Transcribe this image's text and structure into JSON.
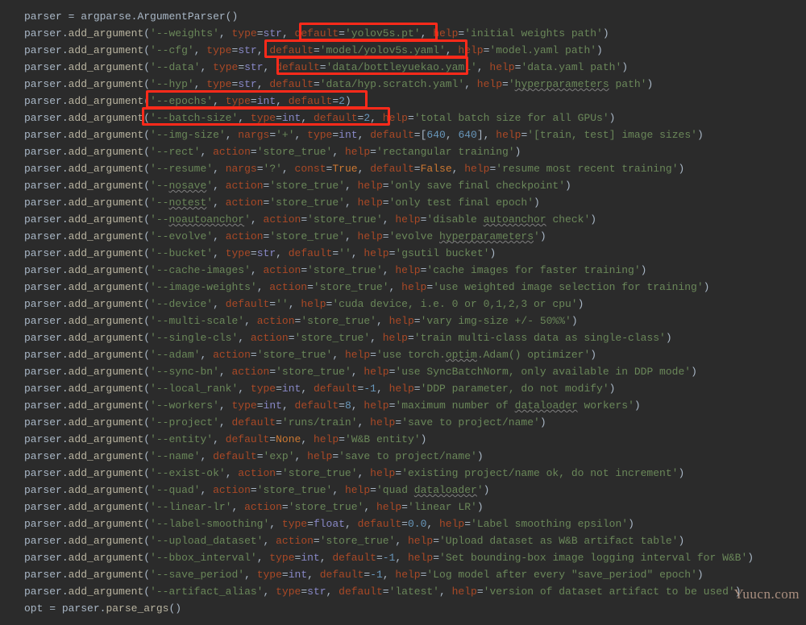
{
  "code": {
    "l1": {
      "v": "parser",
      "a": " = ",
      "m": "argparse",
      "b": ".",
      "f": "ArgumentParser",
      "c": "()"
    },
    "l2": {
      "arg": "'--weights'",
      "type": "str",
      "def": "'yolov5s.pt'",
      "help": "'initial weights path'"
    },
    "l3": {
      "arg": "'--cfg'",
      "type": "str",
      "def": "'model/yolov5s.yaml'",
      "help": "'model.yaml path'"
    },
    "l4": {
      "arg": "'--data'",
      "type": "str",
      "def": "'data/bottleyuekao.yaml'",
      "help": "'data.yaml path'"
    },
    "l5": {
      "arg": "'--hyp'",
      "type": "str",
      "def": "'data/hyp.scratch.yaml'",
      "help_pre": "'",
      "help_w": "hyperparameters",
      "help_post": " path'"
    },
    "l6": {
      "arg": "'--epochs'",
      "type": "int",
      "def": "2"
    },
    "l7": {
      "arg": "'--batch-size'",
      "type": "int",
      "def": "2",
      "help": "'total batch size for all GPUs'"
    },
    "l8": {
      "arg": "'--img-size'",
      "nargs": "'+'",
      "type": "int",
      "list": "[",
      "n1": "640",
      "sep": ", ",
      "n2": "640",
      "close": "]",
      "help": "'[train, test] image sizes'"
    },
    "l9": {
      "arg": "'--rect'",
      "act": "'store_true'",
      "help": "'rectangular training'"
    },
    "l10": {
      "arg": "'--resume'",
      "nargs": "'?'",
      "const": "True",
      "def": "False",
      "help": "'resume most recent training'"
    },
    "l11": {
      "arg": "'--",
      "argw": "nosave",
      "argq": "'",
      "act": "'store_true'",
      "help": "'only save final checkpoint'"
    },
    "l12": {
      "arg": "'--",
      "argw": "notest",
      "argq": "'",
      "act": "'store_true'",
      "help": "'only test final epoch'"
    },
    "l13": {
      "arg": "'--",
      "argw": "noautoanchor",
      "argq": "'",
      "act": "'store_true'",
      "help_pre": "'disable ",
      "help_w": "autoanchor",
      "help_post": " check'"
    },
    "l14": {
      "arg": "'--evolve'",
      "act": "'store_true'",
      "help_pre": "'evolve ",
      "help_w": "hyperparameters",
      "help_post": "'"
    },
    "l15": {
      "arg": "'--bucket'",
      "type": "str",
      "def": "''",
      "help": "'gsutil bucket'"
    },
    "l16": {
      "arg": "'--cache-images'",
      "act": "'store_true'",
      "help": "'cache images for faster training'"
    },
    "l17": {
      "arg": "'--image-weights'",
      "act": "'store_true'",
      "help": "'use weighted image selection for training'"
    },
    "l18": {
      "arg": "'--device'",
      "def": "''",
      "help": "'cuda device, i.e. 0 or 0,1,2,3 or cpu'"
    },
    "l19": {
      "arg": "'--multi-scale'",
      "act": "'store_true'",
      "help": "'vary img-size +/- 50%%'"
    },
    "l20": {
      "arg": "'--single-cls'",
      "act": "'store_true'",
      "help": "'train multi-class data as single-class'"
    },
    "l21": {
      "arg": "'--adam'",
      "act": "'store_true'",
      "help_pre": "'use torch.",
      "help_w": "optim",
      "help_post": ".Adam() optimizer'"
    },
    "l22": {
      "arg": "'--sync-bn'",
      "act": "'store_true'",
      "help": "'use SyncBatchNorm, only available in DDP mode'"
    },
    "l23": {
      "arg": "'--local_rank'",
      "type": "int",
      "def": "-1",
      "help": "'DDP parameter, do not modify'"
    },
    "l24": {
      "arg": "'--workers'",
      "type": "int",
      "def": "8",
      "help_pre": "'maximum number of ",
      "help_w": "dataloader",
      "help_post": " workers'"
    },
    "l25": {
      "arg": "'--project'",
      "def": "'runs/train'",
      "help": "'save to project/name'"
    },
    "l26": {
      "arg": "'--entity'",
      "def": "None",
      "help": "'W&B entity'"
    },
    "l27": {
      "arg": "'--name'",
      "def": "'exp'",
      "help": "'save to project/name'"
    },
    "l28": {
      "arg": "'--exist-ok'",
      "act": "'store_true'",
      "help": "'existing project/name ok, do not increment'"
    },
    "l29": {
      "arg": "'--quad'",
      "act": "'store_true'",
      "help_pre": "'quad ",
      "help_w": "dataloader",
      "help_post": "'"
    },
    "l30": {
      "arg": "'--linear-lr'",
      "act": "'store_true'",
      "help": "'linear LR'"
    },
    "l31": {
      "arg": "'--label-smoothing'",
      "type": "float",
      "def": "0.0",
      "help": "'Label smoothing epsilon'"
    },
    "l32": {
      "arg": "'--upload_dataset'",
      "act": "'store_true'",
      "help": "'Upload dataset as W&B artifact table'"
    },
    "l33": {
      "arg": "'--bbox_interval'",
      "type": "int",
      "def": "-1",
      "help": "'Set bounding-box image logging interval for W&B'"
    },
    "l34": {
      "arg": "'--save_period'",
      "type": "int",
      "def": "-1",
      "help": "'Log model after every \"save_period\" epoch'"
    },
    "l35": {
      "arg": "'--artifact_alias'",
      "type": "str",
      "def": "'latest'",
      "help": "'version of dataset artifact to be used'"
    },
    "l36": {
      "v": "opt",
      "a": " = ",
      "m": "parser",
      "b": ".",
      "f": "parse_args",
      "c": "()"
    }
  },
  "labels": {
    "parser": "parser",
    "dot": ".",
    "add": "add_argument",
    "open": "(",
    "close": ")",
    "comma": ", ",
    "type": "type",
    "eq": "=",
    "default": "default",
    "help": "help",
    "action": "action",
    "nargs": "nargs",
    "const": "const"
  },
  "watermark": "Yuucn.com"
}
